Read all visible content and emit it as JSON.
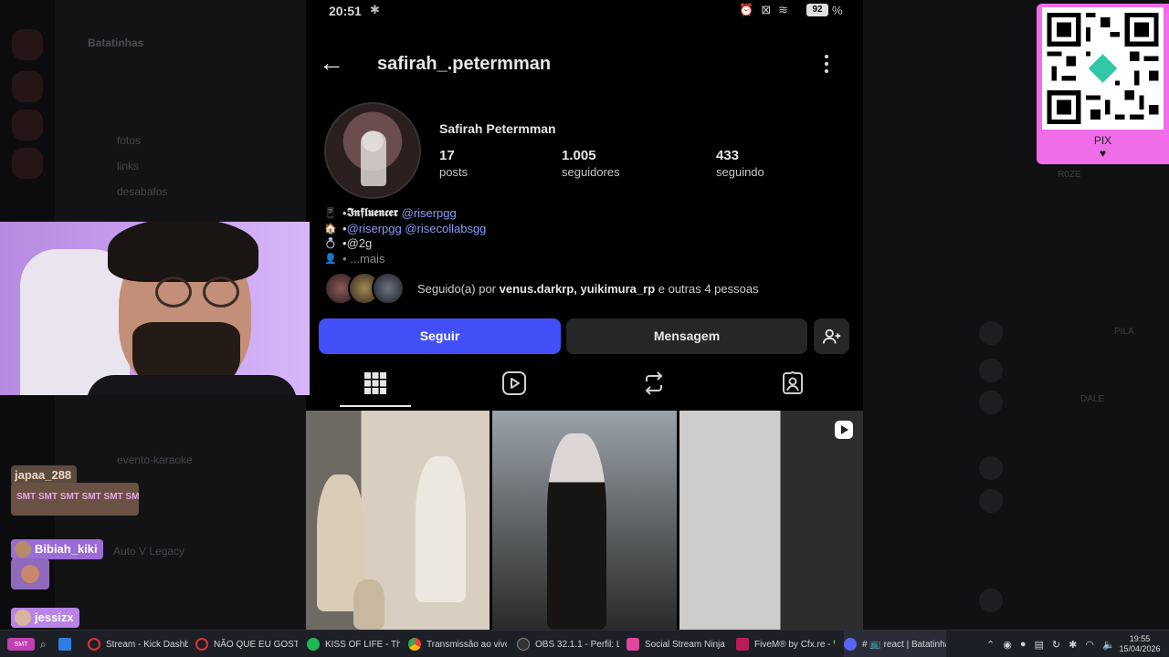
{
  "phone": {
    "time": "20:51",
    "battery": "92",
    "battery_pct": "%"
  },
  "profile": {
    "username": "safirah_.petermman",
    "full_name": "Safirah Petermman",
    "posts": "17",
    "posts_label": "posts",
    "followers": "1.005",
    "followers_label": "seguidores",
    "following": "433",
    "following_label": "seguindo",
    "bio": {
      "line1_prefix": "• ",
      "line1_word": "𝕴𝖓𝖋𝖑𝖚𝖊𝖓𝖈𝖊𝖗",
      "line1_link": "@riserpgg",
      "line2_prefix": "• ",
      "line2_link": "@riserpgg @risecollabsgg",
      "line3_prefix": "• ",
      "line3_text": "@2g",
      "line4_prefix": "• ... ",
      "line4_more": "mais"
    },
    "followed_by_prefix": "Seguido(a) por ",
    "followed_by_names": "venus.darkrp, yuikimura_rp",
    "followed_by_suffix": " e outras 4 pessoas",
    "follow_button": "Seguir",
    "message_button": "Mensagem"
  },
  "qr": {
    "label": "PIX",
    "heart": "♥"
  },
  "discord": {
    "guild": "Batatinhas",
    "channels": [
      "fotos",
      "links",
      "desabafos",
      "evento-karaoke",
      "Auto V Legacy"
    ],
    "members": [
      "PILA",
      "DALE",
      "R0ZE"
    ]
  },
  "chat": [
    {
      "user": "japaa_288",
      "message": "SMT SMT SMT SMT SMT SMT"
    },
    {
      "user": "Bibiah_kiki"
    },
    {
      "user": "jessizx"
    }
  ],
  "taskbar": {
    "items": [
      "Stream - Kick Dashboar",
      "NÃO QUE EU GOSTI",
      "KISS OF LIFE - Think T",
      "Transmissão ao vivo - Y",
      "OBS 32.1.1 - Perfil: LIVES",
      "Social Stream Ninja - De",
      "FiveM® by Cfx.re - 💚 I",
      "# 📺 react | Batatinhas"
    ],
    "clock_time": "19:55",
    "clock_date": "15/04/2026"
  },
  "colors": {
    "follow_button": "#4150f7",
    "link": "#8e9bf5",
    "qr_bg": "#ef6de8",
    "webcam_bg": "#c9a2f2"
  }
}
